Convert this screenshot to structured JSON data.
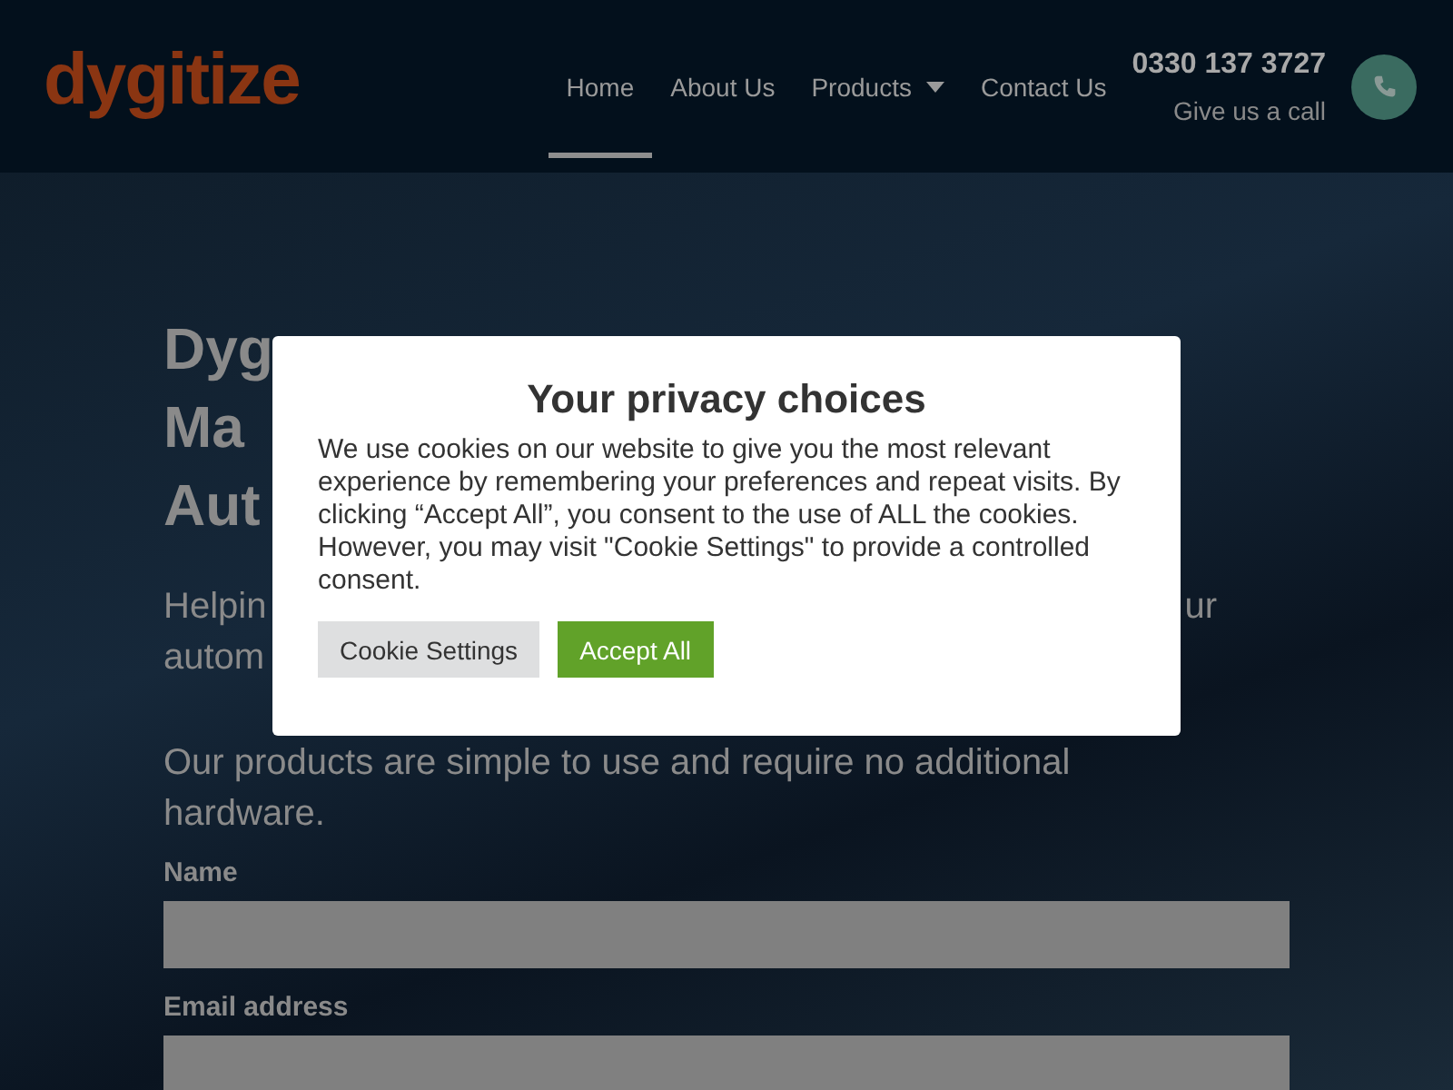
{
  "header": {
    "logo": "dygitize",
    "nav": [
      {
        "label": "Home",
        "selected": true,
        "dropdown": false
      },
      {
        "label": "About Us",
        "selected": false,
        "dropdown": false
      },
      {
        "label": "Products",
        "selected": false,
        "dropdown": true
      },
      {
        "label": "Contact Us",
        "selected": false,
        "dropdown": false
      }
    ],
    "phone": "0330 137 3727",
    "call_hint": "Give us a call"
  },
  "hero": {
    "heading_fragments": [
      "Dyg",
      "Ma",
      "Aut"
    ],
    "intro_fragments": [
      {
        "left": "Helpin",
        "right": "ur"
      },
      {
        "left": "autom"
      }
    ],
    "tagline": "Our products are simple to use and require no additional hardware.",
    "form_fields": [
      {
        "label": "Name"
      },
      {
        "label": "Email address"
      }
    ]
  },
  "cookie_dialog": {
    "title": "Your privacy choices",
    "message": "We use cookies on our website to give you the most relevant experience by remembering your preferences and repeat visits. By clicking “Accept All”, you consent to the use of ALL the cookies. However, you may visit \"Cookie Settings\" to provide a controlled consent.",
    "buttons": [
      {
        "label": "Cookie Settings",
        "kind": "secondary"
      },
      {
        "label": "Accept All",
        "kind": "primary"
      }
    ]
  }
}
